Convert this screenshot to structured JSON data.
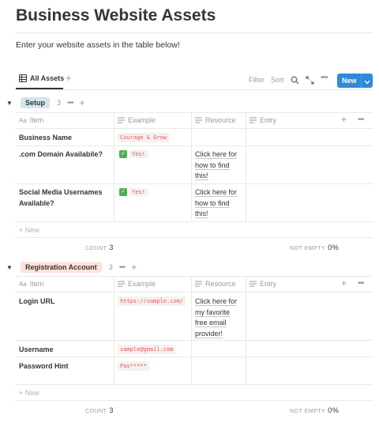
{
  "page": {
    "title": "Business Website Assets",
    "description": "Enter your website assets in the table below!"
  },
  "viewbar": {
    "tab_label": "All Assets",
    "add_view": "+",
    "filter": "Filter",
    "sort": "Sort",
    "more": "•••",
    "new_label": "New"
  },
  "columns": {
    "item": "Item",
    "item_prefix": "Aa",
    "example": "Example",
    "resource": "Resource",
    "entry": "Entry",
    "add": "+",
    "more": "•••"
  },
  "groups": [
    {
      "name": "Setup",
      "count": "3",
      "more": "•••",
      "add": "+",
      "rows": [
        {
          "item": "Business Name",
          "example": "Courage & Grow",
          "resource": ""
        },
        {
          "item": ".com Domain Availabile?",
          "example": "Yes!",
          "resource": "Click here for how to find this!"
        },
        {
          "item": "Social Media Usernames Available?",
          "example": "Yes!",
          "resource": "Click here for how to find this!"
        }
      ],
      "new_row": "+ New",
      "count_label": "COUNT",
      "count_value": "3",
      "notempty_label": "NOT EMPTY",
      "notempty_value": "0%",
      "color": "#d3e5ef"
    },
    {
      "name": "Registration Account",
      "count": "3",
      "more": "•••",
      "add": "+",
      "rows": [
        {
          "item": "Login URL",
          "example": "https://sample.com/",
          "resource": "Click here for my favorite free email provider!"
        },
        {
          "item": "Username",
          "example": "sample@gmail.com",
          "resource": ""
        },
        {
          "item": "Password Hint",
          "example": "Pas*****",
          "resource": ""
        }
      ],
      "new_row": "+ New",
      "count_label": "COUNT",
      "count_value": "3",
      "notempty_label": "NOT EMPTY",
      "notempty_value": "0%",
      "color": "#ffe2dd"
    }
  ],
  "colors": {
    "accent": "#2e8ad8",
    "code_text": "#eb5757",
    "check": "#4caf50"
  }
}
